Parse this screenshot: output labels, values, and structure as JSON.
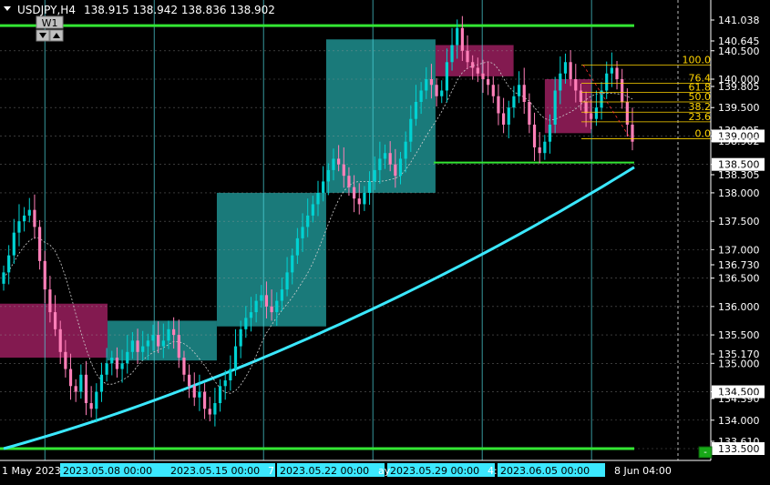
{
  "header": {
    "title": "USDJPY,H4",
    "ohlc": "138.915 138.942 138.836 138.902",
    "period_button": "W1"
  },
  "colors": {
    "background": "#000000",
    "bull": "#00d2d2",
    "bear": "#ff7fb8",
    "ma": "#3be8ff",
    "green_line": "#33e633",
    "grid": "#4fd8e0",
    "zone_pink": "#9a1f5e",
    "zone_teal": "#1f8f8f",
    "fib": "#ffd400",
    "axis_text": "#ffffff"
  },
  "price_axis": {
    "ticks": [
      "141.038",
      "140.645",
      "140.500",
      "140.000",
      "139.805",
      "139.500",
      "139.005",
      "139.000",
      "138.902",
      "138.500",
      "138.305",
      "138.000",
      "137.500",
      "137.000",
      "136.730",
      "136.500",
      "136.000",
      "135.500",
      "135.170",
      "135.000",
      "134.500",
      "134.390",
      "134.000",
      "133.610",
      "133.500"
    ],
    "highlighted": [
      "139.000",
      "138.500",
      "134.500",
      "133.500"
    ]
  },
  "time_axis": {
    "labels": [
      "1 May 2023",
      "2023.05.08 00:00",
      "2023.05.15 00:00",
      "2023.05.22 00:00",
      "2023.05.29 00:00",
      "2023.06.05 00:00",
      "8 Jun 04:00"
    ],
    "boxed": [
      "2023.05.08 00:00",
      "2023.05.15 00:00",
      "2023.05.22 00:00",
      "2023.05.29 00:00",
      "2023.06.05 00:00"
    ],
    "fragments": [
      "7",
      "ay",
      "4:"
    ]
  },
  "fibonacci": [
    "100.0",
    "76.4",
    "61.8",
    "50.0",
    "38.2",
    "23.6",
    "0.0"
  ],
  "chart_data": {
    "type": "candlestick",
    "symbol": "USDJPY",
    "timeframe": "H4",
    "ylim": [
      133.4,
      141.3
    ],
    "horizontal_levels": [
      141.038,
      133.5,
      138.55
    ],
    "zones": [
      {
        "color": "pink",
        "from": "2023-05-01",
        "to": "2023-05-08",
        "low": 135.1,
        "high": 136.05
      },
      {
        "color": "teal",
        "from": "2023-05-08",
        "to": "2023-05-15",
        "low": 135.05,
        "high": 135.75
      },
      {
        "color": "teal",
        "from": "2023-05-15",
        "to": "2023-05-22",
        "low": 135.65,
        "high": 138.0
      },
      {
        "color": "teal",
        "from": "2023-05-22",
        "to": "2023-05-29",
        "low": 138.0,
        "high": 140.7
      },
      {
        "color": "pink",
        "from": "2023-05-29",
        "to": "2023-06-03",
        "low": 140.05,
        "high": 140.6
      },
      {
        "color": "pink",
        "from": "2023-06-05",
        "to": "2023-06-08",
        "low": 139.05,
        "high": 140.0
      }
    ],
    "fib_levels": [
      {
        "label": "100.0",
        "price": 140.25
      },
      {
        "label": "76.4",
        "price": 139.93
      },
      {
        "label": "61.8",
        "price": 139.77
      },
      {
        "label": "50.0",
        "price": 139.6
      },
      {
        "label": "38.2",
        "price": 139.42
      },
      {
        "label": "23.6",
        "price": 139.25
      },
      {
        "label": "0.0",
        "price": 138.95
      }
    ],
    "closes": [
      136.6,
      136.9,
      137.3,
      137.5,
      137.6,
      137.7,
      137.4,
      136.8,
      136.3,
      135.9,
      135.6,
      135.2,
      134.9,
      134.6,
      134.5,
      134.8,
      134.3,
      134.2,
      134.5,
      134.8,
      135.0,
      135.1,
      134.9,
      135.0,
      135.2,
      135.4,
      135.2,
      135.3,
      135.4,
      135.5,
      135.3,
      135.4,
      135.6,
      135.5,
      135.1,
      134.8,
      134.6,
      134.4,
      134.5,
      134.2,
      134.1,
      134.3,
      134.6,
      134.7,
      134.9,
      135.3,
      135.6,
      135.8,
      135.9,
      136.1,
      136.2,
      136.0,
      135.9,
      136.1,
      136.3,
      136.6,
      136.9,
      137.2,
      137.4,
      137.6,
      137.8,
      138.0,
      138.2,
      138.4,
      138.6,
      138.5,
      138.3,
      138.1,
      137.9,
      137.8,
      138.0,
      138.2,
      138.4,
      138.6,
      138.7,
      138.5,
      138.3,
      138.6,
      138.9,
      139.3,
      139.6,
      139.8,
      140.0,
      139.9,
      139.7,
      139.8,
      140.3,
      140.6,
      140.9,
      140.5,
      140.3,
      140.2,
      140.1,
      140.0,
      139.9,
      139.7,
      139.4,
      139.2,
      139.5,
      139.7,
      139.9,
      139.6,
      139.2,
      138.8,
      138.7,
      138.9,
      139.2,
      139.8,
      140.1,
      140.3,
      140.0,
      139.8,
      139.6,
      139.4,
      139.3,
      139.5,
      139.8,
      140.1,
      140.2,
      140.0,
      139.6,
      139.2,
      138.9
    ],
    "ma_start": 133.5,
    "ma_end": 138.45
  }
}
